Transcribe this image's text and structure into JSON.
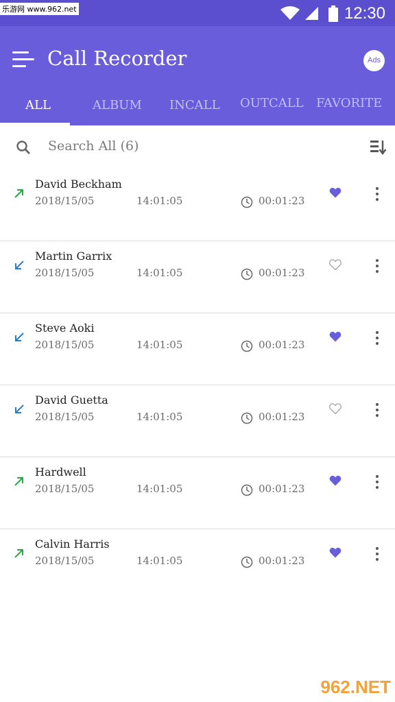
{
  "watermark_top": "乐游网 www.962.net",
  "status": {
    "time": "12:30"
  },
  "app": {
    "title": "Call Recorder",
    "ads_label": "Ads"
  },
  "tabs": [
    {
      "label": "ALL",
      "active": true
    },
    {
      "label": "ALBUM"
    },
    {
      "label": "INCALL"
    },
    {
      "label": "OUTCALL"
    },
    {
      "label": "FAVORITE"
    }
  ],
  "search": {
    "placeholder": "Search All (6)"
  },
  "calls": [
    {
      "name": "David Beckham",
      "date": "2018/15/05",
      "time": "14:01:05",
      "duration": "00:01:23",
      "direction": "outgoing",
      "favorite": true
    },
    {
      "name": "Martin Garrix",
      "date": "2018/15/05",
      "time": "14:01:05",
      "duration": "00:01:23",
      "direction": "incoming",
      "favorite": false
    },
    {
      "name": "Steve Aoki",
      "date": "2018/15/05",
      "time": "14:01:05",
      "duration": "00:01:23",
      "direction": "incoming",
      "favorite": true
    },
    {
      "name": "David Guetta",
      "date": "2018/15/05",
      "time": "14:01:05",
      "duration": "00:01:23",
      "direction": "incoming",
      "favorite": false
    },
    {
      "name": "Hardwell",
      "date": "2018/15/05",
      "time": "14:01:05",
      "duration": "00:01:23",
      "direction": "outgoing",
      "favorite": true
    },
    {
      "name": "Calvin Harris",
      "date": "2018/15/05",
      "time": "14:01:05",
      "duration": "00:01:23",
      "direction": "outgoing",
      "favorite": true
    }
  ],
  "watermark_bottom": "962.NET",
  "colors": {
    "primary": "#6a5ddc",
    "status_bar": "#5b4fcf",
    "outgoing": "#2aa84a",
    "incoming": "#2a7ec8",
    "favorite": "#6a5ddc"
  }
}
